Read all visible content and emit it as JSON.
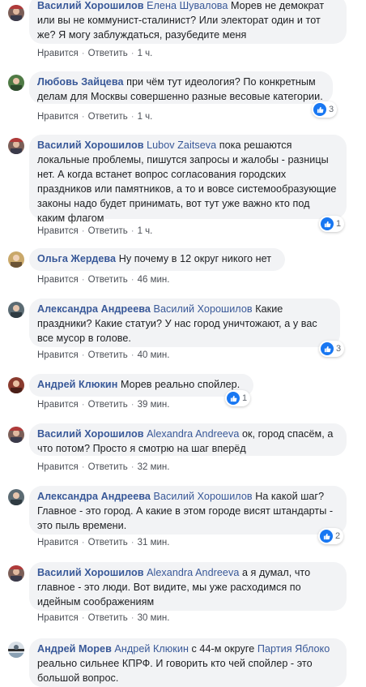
{
  "actions": {
    "like": "Нравится",
    "reply": "Ответить",
    "separator": "·"
  },
  "comments": [
    {
      "author": "Василий Хорошилов",
      "mention": "Елена Шувалова",
      "text": " Морев не демократ или вы не коммунист-сталинист? Или электорат один и тот же? Я могу заблуждаться, разубедите меня",
      "time": "1 ч.",
      "reactions": null
    },
    {
      "author": "Любовь Зайцева",
      "mention": "",
      "text": "при чём тут идеология? По конкретным делам для Москвы совершенно разные весовые категории.",
      "time": "1 ч.",
      "reactions": "3"
    },
    {
      "author": "Василий Хорошилов",
      "mention": "Lubov Zaitseva",
      "text": " пока решаются локальные проблемы, пишутся запросы и жалобы - разницы нет. А когда встанет вопрос согласования городских праздников или памятников, а то и вовсе системообразующие законы надо будет принимать, вот тут уже важно кто под каким флагом",
      "time": "1 ч.",
      "reactions": "1"
    },
    {
      "author": "Ольга Жердева",
      "mention": "",
      "text": "Ну почему в 12 округ никого нет",
      "time": "46 мин.",
      "reactions": null
    },
    {
      "author": "Александра Андреева",
      "mention": "Василий Хорошилов",
      "text": " Какие праздники? Какие статуи? У нас город уничтожают, а у вас все мусор в голове.",
      "time": "40 мин.",
      "reactions": "3"
    },
    {
      "author": "Андрей Клюкин",
      "mention": "",
      "text": "Морев реально спойлер.",
      "time": "39 мин.",
      "reactions": "1"
    },
    {
      "author": "Василий Хорошилов",
      "mention": "Alexandra Andreeva",
      "text": " ок, город спасём, а что потом? Просто я смотрю на шаг вперёд",
      "time": "32 мин.",
      "reactions": null
    },
    {
      "author": "Александра Андреева",
      "mention": "Василий Хорошилов",
      "text": " На какой шаг? Главное - это город. А какие в этом городе висят штандарты - это пыль времени.",
      "time": "31 мин.",
      "reactions": "2"
    },
    {
      "author": "Василий Хорошилов",
      "mention": "Alexandra Andreeva",
      "text": " а я думал, что главное - это люди. Вот видите, мы уже расходимся по идейным соображениям",
      "time": "30 мин.",
      "reactions": null
    },
    {
      "author": "Андрей Морев",
      "mention": "Андрей Клюкин",
      "text": " с 44-м округе ",
      "mention2": "Партия Яблоко",
      "text2": " реально сильнее КПРФ. И говорить кто чей спойлер - это большой вопрос.",
      "time": "",
      "reactions": null
    }
  ],
  "colors": {
    "link": "#385898",
    "bubble": "#f2f3f5",
    "like": "#1877f2"
  }
}
